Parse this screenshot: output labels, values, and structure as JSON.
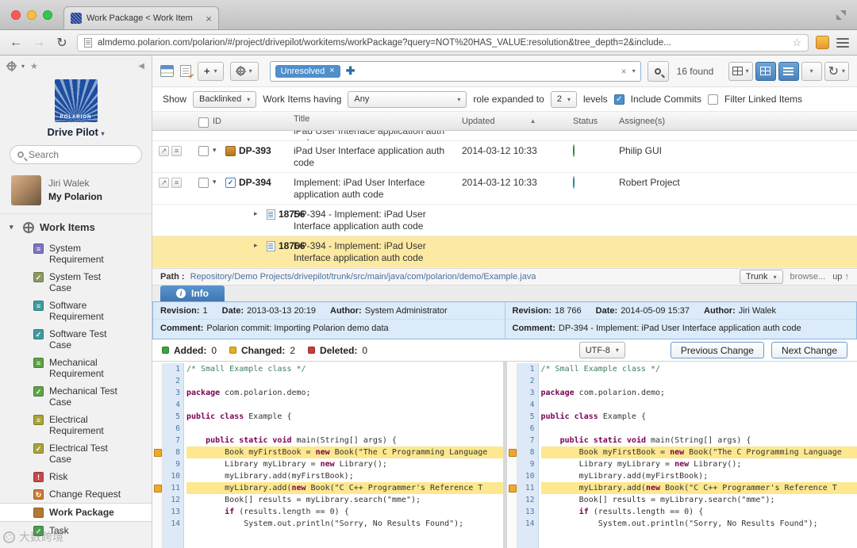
{
  "browser": {
    "tab_title": "Work Package < Work Item",
    "url": "almdemo.polarion.com/polarion/#/project/drivepilot/workitems/workPackage?query=NOT%20HAS_VALUE:resolution&tree_depth=2&include..."
  },
  "sidebar": {
    "logo_text": "POLARION",
    "project_name": "Drive Pilot",
    "search_placeholder": "Search",
    "user_name": "Jiri Walek",
    "user_home": "My Polarion",
    "section": "Work Items",
    "items": [
      {
        "label": "System Requirement",
        "icon": "requirement",
        "color": "#7b74c1"
      },
      {
        "label": "System Test Case",
        "icon": "testcase",
        "color": "#8a9a62"
      },
      {
        "label": "Software Requirement",
        "icon": "requirement",
        "color": "#3f9ba0"
      },
      {
        "label": "Software Test Case",
        "icon": "testcase",
        "color": "#3f9ba0"
      },
      {
        "label": "Mechanical Requirement",
        "icon": "requirement",
        "color": "#5da344"
      },
      {
        "label": "Mechanical Test Case",
        "icon": "testcase",
        "color": "#5da344"
      },
      {
        "label": "Electrical Requirement",
        "icon": "requirement",
        "color": "#a8a23c"
      },
      {
        "label": "Electrical Test Case",
        "icon": "testcase",
        "color": "#a8a23c"
      },
      {
        "label": "Risk",
        "icon": "risk",
        "color": "#c24b4b"
      },
      {
        "label": "Change Request",
        "icon": "change",
        "color": "#cf7a33"
      },
      {
        "label": "Work Package",
        "icon": "workpackage",
        "color": "#b07a35",
        "selected": true
      },
      {
        "label": "Task",
        "icon": "task",
        "color": "#4d9e4d"
      }
    ]
  },
  "query": {
    "chip": "Unresolved",
    "results": "16 found"
  },
  "filters": {
    "show_label": "Show",
    "show_value": "Backlinked",
    "having_label": "Work Items having",
    "having_value": "Any",
    "role_label": "role expanded to",
    "role_value": "2",
    "levels_label": "levels",
    "include_commits_label": "Include Commits",
    "include_commits_checked": true,
    "filter_linked_label": "Filter Linked Items",
    "filter_linked_checked": false
  },
  "table": {
    "columns": [
      "ID",
      "Title",
      "Updated",
      "Status",
      "Assignee(s)"
    ],
    "partial_row_title": "iPad User Interface application auth code",
    "rows": [
      {
        "kind": "workitem",
        "twisty": "expanded",
        "icon": "workpackage",
        "id": "DP-393",
        "title": "iPad User Interface application auth code",
        "updated": "2014-03-12 10:33",
        "status_color": "#3fae49",
        "assignee": "Philip GUI"
      },
      {
        "kind": "workitem",
        "twisty": "expanded",
        "icon": "task",
        "id": "DP-394",
        "title": "Implement: iPad User Interface application auth code",
        "updated": "2014-03-12 10:33",
        "status_color": "#35a9cc",
        "assignee": "Robert Project"
      },
      {
        "kind": "revision",
        "twisty": "collapsed",
        "icon": "revision",
        "id": "18756",
        "title": "DP-394 - Implement: iPad User Interface application auth code"
      },
      {
        "kind": "revision",
        "twisty": "collapsed",
        "icon": "revision",
        "id": "18766",
        "title": "DP-394 - Implement: iPad User Interface application auth code",
        "highlighted": true
      }
    ]
  },
  "pathbar": {
    "label": "Path :",
    "path": "Repository/Demo Projects/drivepilot/trunk/src/main/java/com/polarion/demo/Example.java",
    "branch": "Trunk",
    "browse_label": "browse...",
    "up_label": "up"
  },
  "info_tab_label": "Info",
  "revision_panel": {
    "labels": {
      "revision": "Revision:",
      "date": "Date:",
      "author": "Author:",
      "comment": "Comment:"
    },
    "left": {
      "revision": "1",
      "date": "2013-03-13 20:19",
      "author": "System Administrator",
      "comment": "Polarion commit: Importing Polarion demo data"
    },
    "right": {
      "revision": "18 766",
      "date": "2014-05-09 15:37",
      "author": "Jiri Walek",
      "comment": "DP-394 - Implement: iPad User Interface application auth code"
    }
  },
  "diff": {
    "added_label": "Added:",
    "added_count": "0",
    "changed_label": "Changed:",
    "changed_count": "2",
    "deleted_label": "Deleted:",
    "deleted_count": "0",
    "encoding": "UTF-8",
    "previous_label": "Previous Change",
    "next_label": "Next Change",
    "changed_lines": [
      8,
      11
    ],
    "lines": [
      {
        "n": 1,
        "text": "/* Small Example class */"
      },
      {
        "n": 2,
        "text": ""
      },
      {
        "n": 3,
        "text": "package com.polarion.demo;"
      },
      {
        "n": 4,
        "text": ""
      },
      {
        "n": 5,
        "text": "public class Example {"
      },
      {
        "n": 6,
        "text": ""
      },
      {
        "n": 7,
        "text": "    public static void main(String[] args) {"
      },
      {
        "n": 8,
        "text": "        Book myFirstBook = new Book(\"The C Programming Language"
      },
      {
        "n": 9,
        "text": "        Library myLibrary = new Library();"
      },
      {
        "n": 10,
        "text": "        myLibrary.add(myFirstBook);"
      },
      {
        "n": 11,
        "text": "        myLibrary.add(new Book(\"C C++ Programmer's Reference T"
      },
      {
        "n": 12,
        "text": "        Book[] results = myLibrary.search(\"mme\");"
      },
      {
        "n": 13,
        "text": "        if (results.length == 0) {"
      },
      {
        "n": 14,
        "text": "            System.out.println(\"Sorry, No Results Found\");"
      }
    ]
  },
  "watermark": {
    "text": "大数跨境"
  }
}
